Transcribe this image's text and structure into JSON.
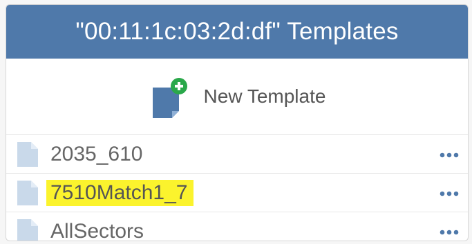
{
  "header": {
    "title": "\"00:11:1c:03:2d:df\" Templates"
  },
  "new_template": {
    "label": "New Template",
    "icon": "new-template-icon"
  },
  "templates": [
    {
      "name": "2035_610",
      "icon": "file-icon",
      "highlighted": false
    },
    {
      "name": "7510Match1_7",
      "icon": "file-icon",
      "highlighted": true
    },
    {
      "name": "AllSectors",
      "icon": "file-icon",
      "highlighted": false
    }
  ],
  "colors": {
    "header_bg": "#4f79aa",
    "accent_green": "#2aa84a",
    "highlight": "#fbf32d",
    "file_icon": "#c9d9ea",
    "more_icon": "#4f79aa"
  }
}
